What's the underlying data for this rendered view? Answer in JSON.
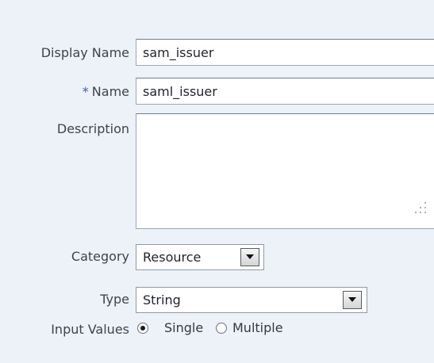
{
  "form": {
    "display_name": {
      "label": "Display Name",
      "value": "sam_issuer"
    },
    "name": {
      "required_marker": "*",
      "label": "Name",
      "value": "saml_issuer"
    },
    "description": {
      "label": "Description",
      "value": ""
    },
    "category": {
      "label": "Category",
      "selected": "Resource",
      "icon": "chevron-down-icon"
    },
    "type": {
      "label": "Type",
      "selected": "String",
      "icon": "chevron-down-icon"
    },
    "input_values": {
      "label": "Input Values",
      "options": [
        {
          "label": "Single",
          "checked": true
        },
        {
          "label": "Multiple",
          "checked": false
        }
      ]
    }
  },
  "colors": {
    "background": "#edf2f8",
    "field_border": "#9aa7b8",
    "label_text": "#3d444b",
    "required_star": "#3d5f9a"
  }
}
